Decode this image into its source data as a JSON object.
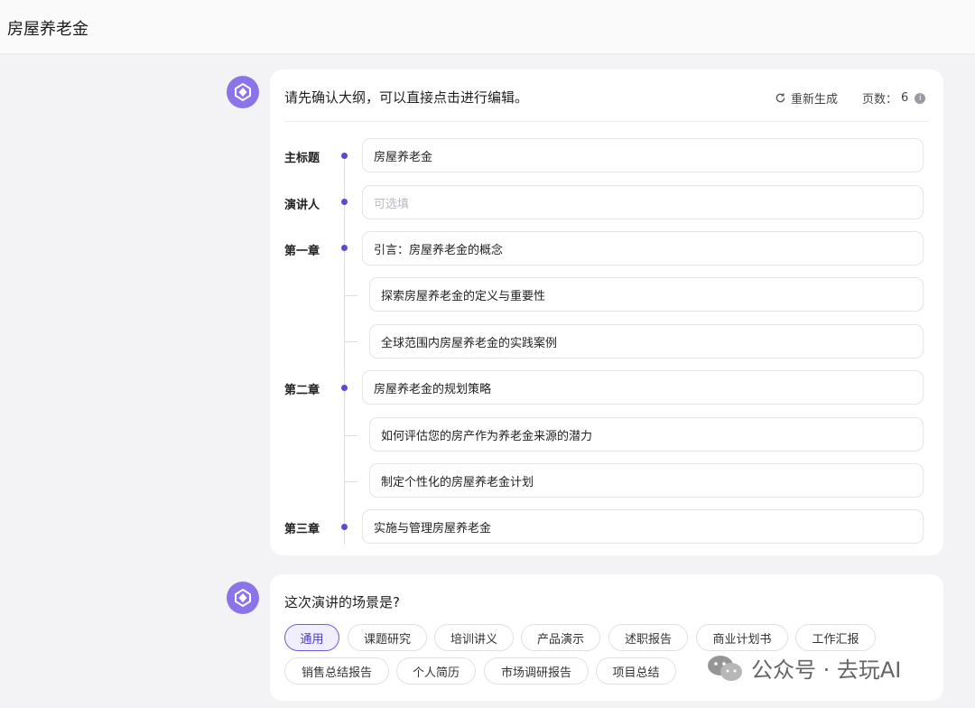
{
  "header": {
    "title": "房屋养老金"
  },
  "outline_card": {
    "prompt": "请先确认大纲，可以直接点击进行编辑。",
    "regenerate_label": "重新生成",
    "pages_label": "页数：",
    "pages_value": "6",
    "rows": [
      {
        "label": "主标题",
        "value": "房屋养老金"
      },
      {
        "label": "演讲人",
        "placeholder": "可选填"
      },
      {
        "label": "第一章",
        "value": "引言：房屋养老金的概念"
      },
      {
        "sub": "探索房屋养老金的定义与重要性"
      },
      {
        "sub": "全球范围内房屋养老金的实践案例"
      },
      {
        "label": "第二章",
        "value": "房屋养老金的规划策略"
      },
      {
        "sub": "如何评估您的房产作为养老金来源的潜力"
      },
      {
        "sub": "制定个性化的房屋养老金计划"
      },
      {
        "label": "第三章",
        "value": "实施与管理房屋养老金"
      }
    ]
  },
  "scene_card": {
    "question": "这次演讲的场景是?",
    "chips": [
      "通用",
      "课题研究",
      "培训讲义",
      "产品演示",
      "述职报告",
      "商业计划书",
      "工作汇报",
      "销售总结报告",
      "个人简历",
      "市场调研报告",
      "项目总结"
    ],
    "selected": "通用"
  },
  "watermark": {
    "text": "公众号 · 去玩AI"
  },
  "colors": {
    "accent": "#5b4bd1",
    "avatar": "#8a74e8"
  },
  "icons": {
    "avatar": "ai-logo-icon",
    "regenerate": "refresh-icon",
    "info": "info-icon",
    "watermark": "wechat-icon"
  }
}
